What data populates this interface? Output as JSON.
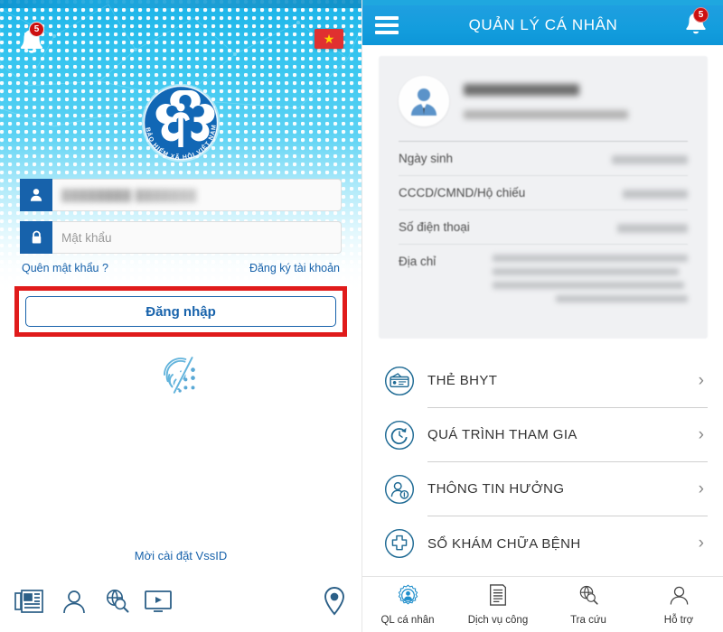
{
  "login": {
    "notification_badge": "5",
    "flag_icon": "vietnam-flag-icon",
    "logo_text": "BẢO HIỂM XÃ HỘI VIỆT NAM",
    "username_value": "████████ ███████",
    "password_placeholder": "Mật khẩu",
    "forgot_password": "Quên mật khẩu ?",
    "register_account": "Đăng ký tài khoản",
    "login_button": "Đăng nhập",
    "fingerprint_icon": "fingerprint-icon",
    "invite_text": "Mời cài đặt VssID",
    "bottom_icons": [
      {
        "name": "news-icon",
        "label": "news"
      },
      {
        "name": "support-person-icon",
        "label": "support"
      },
      {
        "name": "lookup-search-icon",
        "label": "lookup"
      },
      {
        "name": "video-icon",
        "label": "video"
      },
      {
        "name": "location-pin-icon",
        "label": "location"
      }
    ]
  },
  "profile": {
    "menu_icon": "hamburger-menu-icon",
    "title": "QUẢN LÝ CÁ NHÂN",
    "notification_badge": "5",
    "card": {
      "avatar_icon": "user-avatar-icon",
      "name_value": "████ ███ ████",
      "sub_value": "███ ██ ████ - ██████████",
      "rows": [
        {
          "label": "Ngày sinh",
          "value": "██████████"
        },
        {
          "label": "CCCD/CMND/Hộ chiếu",
          "value": "███████████"
        },
        {
          "label": "Số điện thoại",
          "value": "███████████"
        },
        {
          "label": "Địa chỉ",
          "value": "████████, ███ ██ - ████████ ████ ███, ██ ████ ██████, ███ ██ ████, ████████ ████ ███, ████ ████ ████ ██████, ████ ██ ██████"
        }
      ]
    },
    "menu_items": [
      {
        "icon": "health-insurance-card-icon",
        "label": "THẺ BHYT",
        "chevron": "›"
      },
      {
        "icon": "history-refresh-icon",
        "label": "QUÁ TRÌNH THAM GIA",
        "chevron": "›"
      },
      {
        "icon": "person-info-icon",
        "label": "THÔNG TIN HƯỞNG",
        "chevron": "›"
      },
      {
        "icon": "medical-cross-icon",
        "label": "SỔ KHÁM CHỮA BỆNH",
        "chevron": "›"
      }
    ],
    "tabs": [
      {
        "icon": "personal-gear-icon",
        "label": "QL cá nhân",
        "active": true
      },
      {
        "icon": "public-service-doc-icon",
        "label": "Dịch vụ công",
        "active": false
      },
      {
        "icon": "lookup-search-icon",
        "label": "Tra cứu",
        "active": false
      },
      {
        "icon": "support-person-icon",
        "label": "Hỗ trợ",
        "active": false
      }
    ]
  },
  "colors": {
    "appbar_blue": "#139ddd",
    "brand_blue": "#1762ab",
    "highlight_red": "#e01b1b",
    "badge_red": "#cc1111"
  }
}
